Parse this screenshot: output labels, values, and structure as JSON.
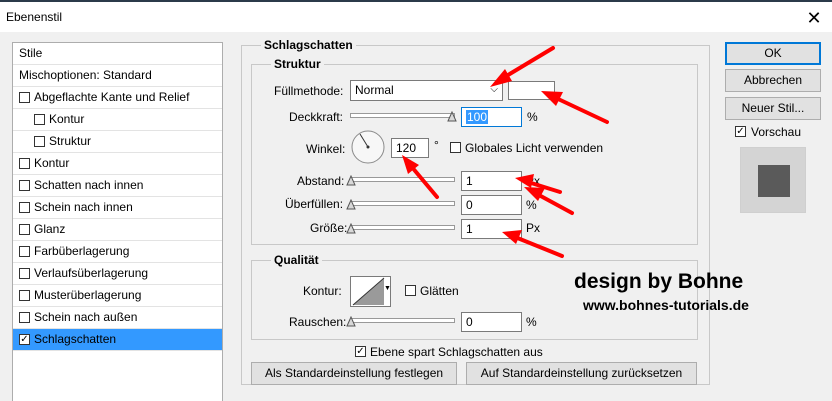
{
  "window": {
    "title": "Ebenenstil",
    "close_glyph": "✕"
  },
  "styles_panel": {
    "items": [
      {
        "label": "Stile",
        "checkbox": false,
        "checked": false,
        "indent": 0
      },
      {
        "label": "Mischoptionen: Standard",
        "checkbox": false,
        "checked": false,
        "indent": 0
      },
      {
        "label": "Abgeflachte Kante und Relief",
        "checkbox": true,
        "checked": false,
        "indent": 0
      },
      {
        "label": "Kontur",
        "checkbox": true,
        "checked": false,
        "indent": 1
      },
      {
        "label": "Struktur",
        "checkbox": true,
        "checked": false,
        "indent": 1
      },
      {
        "label": "Kontur",
        "checkbox": true,
        "checked": false,
        "indent": 0
      },
      {
        "label": "Schatten nach innen",
        "checkbox": true,
        "checked": false,
        "indent": 0
      },
      {
        "label": "Schein nach innen",
        "checkbox": true,
        "checked": false,
        "indent": 0
      },
      {
        "label": "Glanz",
        "checkbox": true,
        "checked": false,
        "indent": 0
      },
      {
        "label": "Farbüberlagerung",
        "checkbox": true,
        "checked": false,
        "indent": 0
      },
      {
        "label": "Verlaufsüberlagerung",
        "checkbox": true,
        "checked": false,
        "indent": 0
      },
      {
        "label": "Musterüberlagerung",
        "checkbox": true,
        "checked": false,
        "indent": 0
      },
      {
        "label": "Schein nach außen",
        "checkbox": true,
        "checked": false,
        "indent": 0
      },
      {
        "label": "Schlagschatten",
        "checkbox": true,
        "checked": true,
        "indent": 0,
        "selected": true
      }
    ]
  },
  "main": {
    "section_title": "Schlagschatten",
    "structure": {
      "title": "Struktur",
      "blend_mode_label": "Füllmethode:",
      "blend_mode_value": "Normal",
      "opacity_label": "Deckkraft:",
      "opacity_value": "100",
      "opacity_unit": "%",
      "angle_label": "Winkel:",
      "angle_value": "120",
      "angle_unit": "°",
      "global_light_label": "Globales Licht verwenden",
      "distance_label": "Abstand:",
      "distance_value": "1",
      "distance_unit": "Px",
      "spread_label": "Überfüllen:",
      "spread_value": "0",
      "spread_unit": "%",
      "size_label": "Größe:",
      "size_value": "1",
      "size_unit": "Px"
    },
    "quality": {
      "title": "Qualität",
      "contour_label": "Kontur:",
      "antialias_label": "Glätten",
      "noise_label": "Rauschen:",
      "noise_value": "0",
      "noise_unit": "%"
    },
    "knocks_out_label": "Ebene spart Schlagschatten aus",
    "knocks_out_checked": true,
    "make_default_label": "Als Standardeinstellung festlegen",
    "reset_default_label": "Auf Standardeinstellung zurücksetzen"
  },
  "right_panel": {
    "ok_label": "OK",
    "cancel_label": "Abbrechen",
    "new_style_label": "Neuer Stil...",
    "preview_label": "Vorschau",
    "preview_checked": true
  },
  "watermark": {
    "line1": "design by Bohne",
    "line2": "www.bohnes-tutorials.de"
  },
  "colors": {
    "selection": "#3399ff",
    "annotation_arrow": "#ff0000",
    "ok_border": "#0078d7"
  }
}
